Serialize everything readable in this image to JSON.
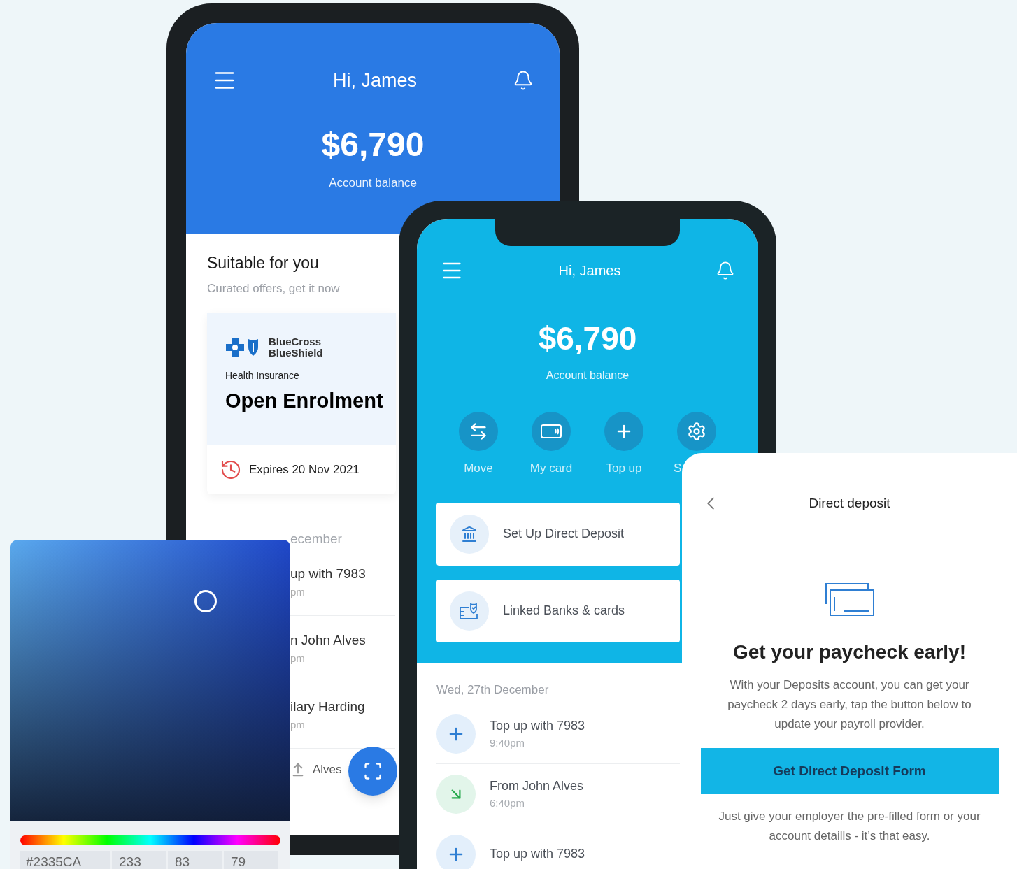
{
  "left_phone": {
    "greeting": "Hi, James",
    "balance": "$6,790",
    "balance_label": "Account balance",
    "section_title": "Suitable for you",
    "section_subtitle": "Curated offers, get it now",
    "offer": {
      "brand_lines": [
        "BlueCross",
        "BlueShield"
      ],
      "category": "Health Insurance",
      "title": "Open Enrolment",
      "expiry": "Expires 20 Nov 2021"
    },
    "list_heading": "ecember",
    "transactions": [
      {
        "title": "up with 7983",
        "time": "pm"
      },
      {
        "title": "n John Alves",
        "time": "pm"
      },
      {
        "title": "ilary Harding",
        "time": "pm"
      }
    ],
    "nav_label": "Alves"
  },
  "color_picker": {
    "hex": "#2335CA",
    "values": [
      "233",
      "83",
      "79"
    ]
  },
  "middle_phone": {
    "greeting": "Hi, James",
    "balance": "$6,790",
    "balance_label": "Account balance",
    "actions": [
      {
        "label": "Move",
        "kind": "move"
      },
      {
        "label": "My card",
        "kind": "card"
      },
      {
        "label": "Top up",
        "kind": "topup"
      },
      {
        "label": "S",
        "kind": "settings"
      }
    ],
    "links": [
      {
        "label": "Set Up Direct Deposit",
        "kind": "bank"
      },
      {
        "label": "Linked Banks & cards",
        "kind": "linked"
      }
    ],
    "date": "Wed, 27th December",
    "transactions": [
      {
        "title": "Top up with 7983",
        "time": "9:40pm",
        "kind": "topup"
      },
      {
        "title": "From John Alves",
        "time": "6:40pm",
        "kind": "incoming"
      },
      {
        "title": "Top up with 7983",
        "kind": "topup"
      }
    ]
  },
  "deposit_panel": {
    "title": "Direct deposit",
    "heading": "Get your paycheck early!",
    "body": "With your Deposits account, you can get your paycheck 2 days early, tap the button below to update your payroll provider.",
    "button": "Get Direct Deposit Form",
    "footer": "Just give your employer the pre-filled form or your account detaills - it’s that easy."
  }
}
